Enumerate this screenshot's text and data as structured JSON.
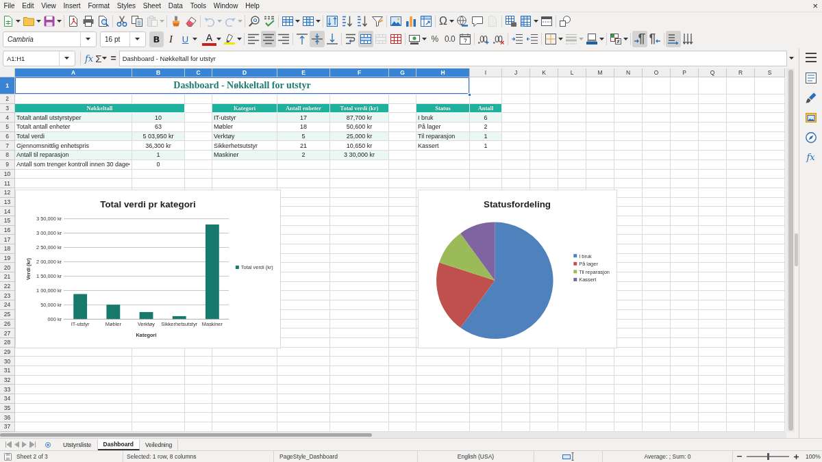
{
  "menu_bar": {
    "items": [
      "File",
      "Edit",
      "View",
      "Insert",
      "Format",
      "Styles",
      "Sheet",
      "Data",
      "Tools",
      "Window",
      "Help"
    ],
    "close": "×"
  },
  "standard_toolbar": {
    "paste": {
      "disabled": true
    },
    "undo": {
      "disabled": true
    },
    "redo": {
      "disabled": true
    },
    "special_character": {
      "label": "Ω"
    },
    "headers_footers": {
      "disabled": true
    }
  },
  "formatting_toolbar": {
    "font_name": {
      "value": "Cambria"
    },
    "font_size": {
      "value": "16 pt"
    },
    "bold": {
      "label": "B",
      "on": true
    },
    "italic": {
      "label": "I",
      "on": false
    },
    "underline": {
      "label": "U",
      "on": false
    },
    "font_color": {
      "label": "A"
    },
    "horizontal_align": [
      {
        "kind": "left",
        "selected": false
      },
      {
        "kind": "center",
        "selected": true
      },
      {
        "kind": "right",
        "selected": false
      }
    ],
    "vertical_align": [
      {
        "kind": "top",
        "selected": false
      },
      {
        "kind": "center",
        "selected": true
      },
      {
        "kind": "bottom",
        "selected": false
      }
    ],
    "merge_and_center": {
      "on": true
    },
    "merge_cells": {
      "disabled": true
    },
    "percent": {
      "label": "%"
    },
    "number_format": {
      "label": "0.0"
    },
    "border_style": {
      "disabled": true
    },
    "paragraph_direction": [
      {
        "kind": "ltr",
        "selected": true
      },
      {
        "kind": "rtl",
        "selected": false
      }
    ],
    "text_direction": [
      {
        "kind": "horizontal",
        "selected": true
      },
      {
        "kind": "vertical",
        "selected": false
      }
    ]
  },
  "formula_bar": {
    "name_box": "A1:H1",
    "function_wizard": "fx",
    "sum": "Σ",
    "equals": "=",
    "content": "Dashboard - Nøkkeltall for utstyr"
  },
  "sidebar": {
    "functions_label": "fx"
  },
  "sheet": {
    "columns": [
      {
        "label": "A",
        "selected": true
      },
      {
        "label": "B",
        "selected": true
      },
      {
        "label": "C",
        "selected": true
      },
      {
        "label": "D",
        "selected": true
      },
      {
        "label": "E",
        "selected": true
      },
      {
        "label": "F",
        "selected": true
      },
      {
        "label": "G",
        "selected": true
      },
      {
        "label": "H",
        "selected": true
      },
      {
        "label": "I",
        "selected": false
      },
      {
        "label": "J",
        "selected": false
      },
      {
        "label": "K",
        "selected": false
      },
      {
        "label": "L",
        "selected": false
      },
      {
        "label": "M",
        "selected": false
      },
      {
        "label": "N",
        "selected": false
      },
      {
        "label": "O",
        "selected": false
      },
      {
        "label": "P",
        "selected": false
      },
      {
        "label": "Q",
        "selected": false
      },
      {
        "label": "R",
        "selected": false
      },
      {
        "label": "S",
        "selected": false
      }
    ],
    "rows": [
      {
        "label": "1",
        "selected": true
      },
      {
        "label": "2",
        "selected": false
      },
      {
        "label": "3",
        "selected": false
      },
      {
        "label": "4",
        "selected": false
      },
      {
        "label": "5",
        "selected": false
      },
      {
        "label": "6",
        "selected": false
      },
      {
        "label": "7",
        "selected": false
      },
      {
        "label": "8",
        "selected": false
      },
      {
        "label": "9",
        "selected": false
      },
      {
        "label": "10",
        "selected": false
      },
      {
        "label": "11",
        "selected": false
      },
      {
        "label": "12",
        "selected": false
      },
      {
        "label": "13",
        "selected": false
      },
      {
        "label": "14",
        "selected": false
      },
      {
        "label": "15",
        "selected": false
      },
      {
        "label": "16",
        "selected": false
      },
      {
        "label": "17",
        "selected": false
      },
      {
        "label": "18",
        "selected": false
      },
      {
        "label": "19",
        "selected": false
      },
      {
        "label": "20",
        "selected": false
      },
      {
        "label": "21",
        "selected": false
      },
      {
        "label": "22",
        "selected": false
      },
      {
        "label": "23",
        "selected": false
      },
      {
        "label": "24",
        "selected": false
      },
      {
        "label": "25",
        "selected": false
      },
      {
        "label": "26",
        "selected": false
      },
      {
        "label": "27",
        "selected": false
      },
      {
        "label": "28",
        "selected": false
      },
      {
        "label": "29",
        "selected": false
      },
      {
        "label": "30",
        "selected": false
      },
      {
        "label": "31",
        "selected": false
      },
      {
        "label": "32",
        "selected": false
      },
      {
        "label": "33",
        "selected": false
      },
      {
        "label": "34",
        "selected": false
      },
      {
        "label": "35",
        "selected": false
      },
      {
        "label": "36",
        "selected": false
      },
      {
        "label": "37",
        "selected": false
      }
    ],
    "title": {
      "text": "Dashboard - Nøkkeltall for utstyr",
      "selected": true
    },
    "key_figures": {
      "header": "Nøkkeltall",
      "rows": [
        {
          "label": "Totalt antall utstyrstyper",
          "value": "10",
          "clipped": false
        },
        {
          "label": "Totalt antall enheter",
          "value": "63",
          "clipped": false
        },
        {
          "label": "Total verdi",
          "value": "5 03,950 kr",
          "clipped": false
        },
        {
          "label": "Gjennomsnittlig enhetspris",
          "value": "36,300 kr",
          "clipped": false
        },
        {
          "label": "Antall til reparasjon",
          "value": "1",
          "clipped": false
        },
        {
          "label": "Antall som trenger kontroll innen 30 dage",
          "value": "0",
          "clipped": true
        }
      ]
    },
    "category_table": {
      "columns": [
        "Kategori",
        "Antall enheter",
        "Total verdi (kr)"
      ],
      "rows": [
        [
          "IT-utstyr",
          "17",
          "87,700 kr"
        ],
        [
          "Møbler",
          "18",
          "50,600 kr"
        ],
        [
          "Verktøy",
          "5",
          "25,000 kr"
        ],
        [
          "Sikkerhetsutstyr",
          "21",
          "10,650 kr"
        ],
        [
          "Maskiner",
          "2",
          "3 30,000 kr"
        ]
      ]
    },
    "status_table": {
      "columns": [
        "Status",
        "Antall"
      ],
      "rows": [
        [
          "I bruk",
          "6"
        ],
        [
          "På lager",
          "2"
        ],
        [
          "Til reparasjon",
          "1"
        ],
        [
          "Kassert",
          "1"
        ]
      ]
    }
  },
  "bar_chart": {
    "chart_data": {
      "type": "bar",
      "title": "Total verdi pr kategori",
      "xlabel": "Kategori",
      "ylabel": "Verdi (kr)",
      "categories": [
        "IT-utstyr",
        "Møbler",
        "Verktøy",
        "Sikkerhetsutstyr",
        "Maskiner"
      ],
      "series": [
        {
          "name": "Total verdi (kr)",
          "color": "#17796b",
          "values": [
            87700,
            50600,
            25000,
            10650,
            330000
          ]
        }
      ],
      "ylim": [
        0,
        350000
      ],
      "yticks": [
        {
          "value": 0,
          "label": "000 kr"
        },
        {
          "value": 50000,
          "label": "50,000 kr"
        },
        {
          "value": 100000,
          "label": "1 00,000 kr"
        },
        {
          "value": 150000,
          "label": "1 50,000 kr"
        },
        {
          "value": 200000,
          "label": "2 00,000 kr"
        },
        {
          "value": 250000,
          "label": "2 50,000 kr"
        },
        {
          "value": 300000,
          "label": "3 00,000 kr"
        },
        {
          "value": 350000,
          "label": "3 50,000 kr"
        }
      ],
      "grid": true,
      "legend": true
    }
  },
  "pie_chart": {
    "chart_data": {
      "type": "pie",
      "title": "Statusfordeling",
      "categories": [
        "I bruk",
        "På lager",
        "Til reparasjon",
        "Kassert"
      ],
      "values": [
        60,
        20,
        10,
        10
      ],
      "colors": [
        "#4f81bd",
        "#c0504d",
        "#9bbb59",
        "#8064a2"
      ],
      "legend": true
    }
  },
  "sheet_tabs": [
    {
      "label": "Utstyrsliste",
      "selected": false
    },
    {
      "label": "Dashboard",
      "selected": true
    },
    {
      "label": "Veiledning",
      "selected": false
    }
  ],
  "status_bar": {
    "sheet": "Sheet 2 of 3",
    "selection": "Selected: 1 row, 8 columns",
    "page_style": "PageStyle_Dashboard",
    "language": "English (USA)",
    "statistics": "Average: ; Sum: 0",
    "zoom": {
      "level": 0.5,
      "value": "100%"
    }
  }
}
